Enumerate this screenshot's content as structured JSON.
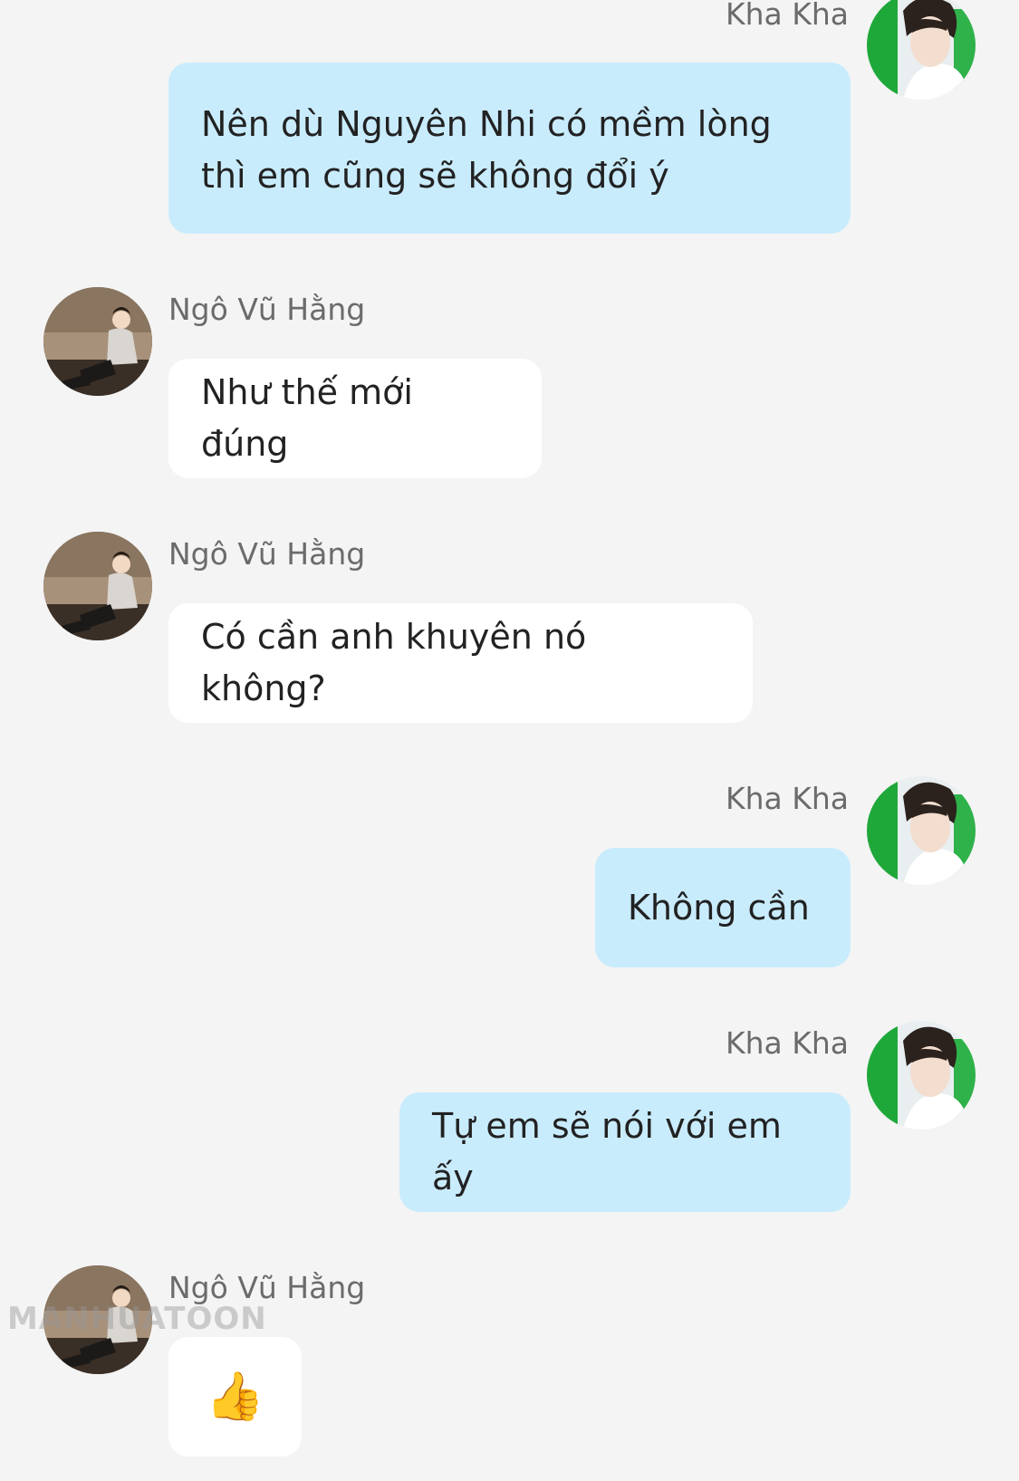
{
  "messages": [
    {
      "sender": "Kha Kha",
      "direction": "out",
      "text": "Nên dù Nguyên Nhi có mềm lòng thì em cũng sẽ không đổi ý"
    },
    {
      "sender": "Ngô Vũ Hằng",
      "direction": "in",
      "text": "Như thế mới đúng"
    },
    {
      "sender": "Ngô Vũ Hằng",
      "direction": "in",
      "text": "Có cần anh khuyên nó không?"
    },
    {
      "sender": "Kha Kha",
      "direction": "out",
      "text": "Không cần"
    },
    {
      "sender": "Kha Kha",
      "direction": "out",
      "text": "Tự em sẽ nói với em ấy"
    },
    {
      "sender": "Ngô Vũ Hằng",
      "direction": "in",
      "text": "👍",
      "icon": "thumbs-up-icon"
    }
  ],
  "watermark": "MANHUATOON",
  "colors": {
    "background": "#f4f4f4",
    "outgoing_bubble": "#c9ecfd",
    "incoming_bubble": "#ffffff",
    "sender_name": "#6b6b6b",
    "message_text": "#222222"
  }
}
